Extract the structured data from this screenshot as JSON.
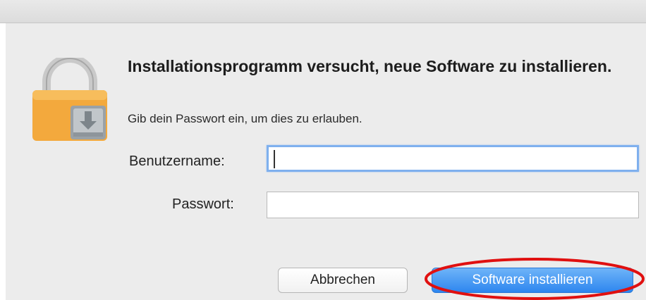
{
  "dialog": {
    "title": "Installationsprogramm versucht, neue Software zu installieren.",
    "subtitle": "Gib dein Passwort ein, um dies zu erlauben.",
    "icon": "lock-installer-icon"
  },
  "form": {
    "username_label": "Benutzername:",
    "username_value": "",
    "password_label": "Passwort:",
    "password_value": ""
  },
  "buttons": {
    "cancel": "Abbrechen",
    "install": "Software installieren"
  },
  "colors": {
    "primary_button": "#2d86ef",
    "highlight_annotation": "#e01010",
    "focus_ring": "#7fb0ee"
  }
}
